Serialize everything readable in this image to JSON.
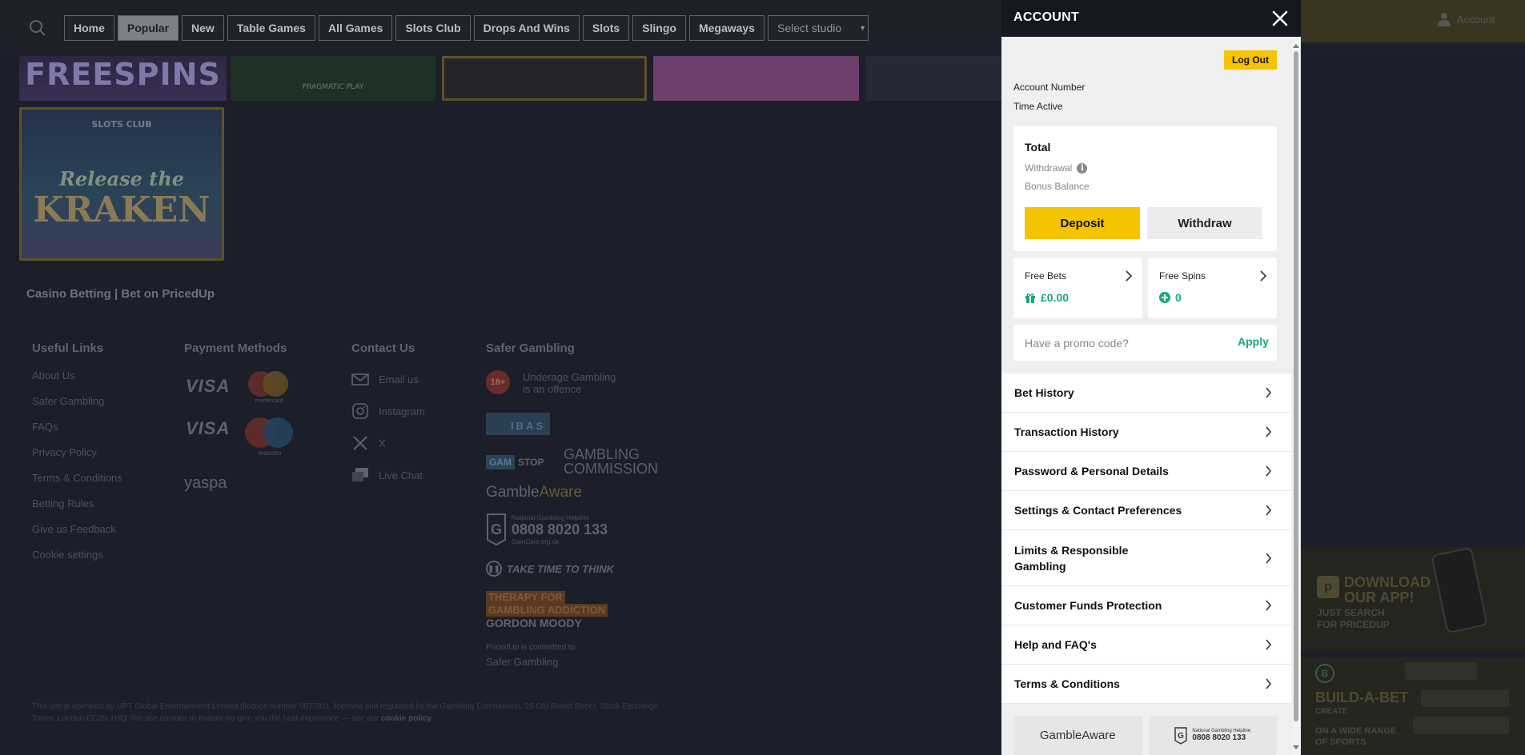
{
  "nav": {
    "tabs": [
      {
        "label": "Home",
        "active": false
      },
      {
        "label": "Popular",
        "active": true
      },
      {
        "label": "New",
        "active": false
      },
      {
        "label": "Table Games",
        "active": false
      },
      {
        "label": "All Games",
        "active": false
      },
      {
        "label": "Slots Club",
        "active": false
      },
      {
        "label": "Drops And Wins",
        "active": false
      },
      {
        "label": "Slots",
        "active": false
      },
      {
        "label": "Slingo",
        "active": false
      },
      {
        "label": "Megaways",
        "active": false
      }
    ],
    "studio_select": "Select studio",
    "account_link": "Account"
  },
  "games": {
    "freespins_title": "FREESPINS",
    "pragmatic_label": "PRAGMATIC PLAY",
    "kraken_club": "SLOTS CLUB",
    "kraken_title_1": "Release the",
    "kraken_title_2": "KRAKEN"
  },
  "footer": {
    "title": "Casino Betting | Bet on PricedUp",
    "useful_links": {
      "heading": "Useful Links",
      "items": [
        "About Us",
        "Safer Gambling",
        "FAQs",
        "Privacy Policy",
        "Terms & Conditions",
        "Betting Rules",
        "Give us Feedback",
        "Cookie settings"
      ]
    },
    "payment_methods": {
      "heading": "Payment Methods",
      "visa": "VISA",
      "mastercard": "mastercard",
      "maestro": "maestro",
      "yaspa": "yaspa"
    },
    "contact": {
      "heading": "Contact Us",
      "items": [
        "Email us",
        "Instagram",
        "X",
        "Live Chat"
      ]
    },
    "safer_gambling": {
      "heading": "Safer Gambling",
      "age_badge": "18+",
      "underage_1": "Underage Gambling",
      "underage_2": "is an offence",
      "ibas": "IBAS",
      "gamstop_1": "GAM",
      "gamstop_2": "STOP",
      "commission_1": "GAMBLING",
      "commission_2": "COMMISSION",
      "gambleaware_1": "Gamble",
      "gambleaware_2": "Aware",
      "helpline_label": "National Gambling Helpline",
      "helpline_number": "0808 8020 133",
      "helpline_site": "GamCare.org.uk",
      "take_time": "TAKE TIME TO THINK",
      "therapy_1": "THERAPY FOR",
      "therapy_2": "GAMBLING ADDICTION",
      "gordon_moody": "GORDON MOODY",
      "committed_1": "PricedUp is committed to",
      "committed_2": "Safer Gambling"
    },
    "legal_text": "This site is operated by UPT Global Entertainment Limited (licence number 007781), licensed and regulated by the Gambling Commission. 25 Old Broad Street, Stock Exchange Tower, London EC2N 1HQ. We use cookies to ensure we give you the best experience — see our",
    "cookie_policy": "cookie policy"
  },
  "banners": {
    "download_1": "DOWNLOAD",
    "download_2": "OUR APP!",
    "download_3": "JUST SEARCH",
    "download_4": "FOR PRICEDUP",
    "build_1": "BUILD-A-BET",
    "build_2": "CREATE",
    "build_3": "ON A WIDE RANGE",
    "build_4": "OF SPORTS"
  },
  "account": {
    "title": "ACCOUNT",
    "logout": "Log Out",
    "account_number_label": "Account Number",
    "time_active_label": "Time Active",
    "total_label": "Total",
    "withdrawal_label": "Withdrawal",
    "info_glyph": "i",
    "bonus_label": "Bonus Balance",
    "deposit": "Deposit",
    "withdraw": "Withdraw",
    "free_bets_label": "Free Bets",
    "free_bets_value": "£0.00",
    "free_spins_label": "Free Spins",
    "free_spins_value": "0",
    "promo_placeholder": "Have a promo code?",
    "apply": "Apply",
    "menu": [
      {
        "label": "Bet History"
      },
      {
        "label": "Transaction History"
      },
      {
        "label": "Password & Personal Details"
      },
      {
        "label": "Settings & Contact Preferences"
      },
      {
        "label": "Limits & Responsible Gambling"
      },
      {
        "label": "Customer Funds Protection"
      },
      {
        "label": "Help and FAQ's"
      },
      {
        "label": "Terms & Conditions"
      }
    ],
    "gambleaware_logo": "GambleAware",
    "helpline_logo_label": "National Gambling Helpline",
    "helpline_logo_number": "0808 8020 133"
  },
  "colors": {
    "accent": "#f4c400",
    "positive": "#1aa77c",
    "panel_header": "#161820"
  }
}
